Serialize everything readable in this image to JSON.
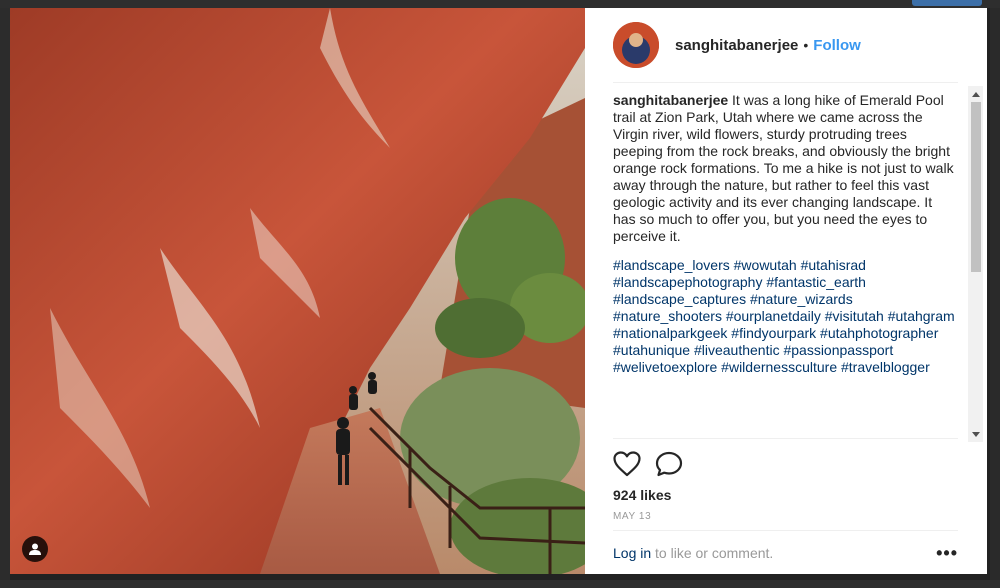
{
  "post": {
    "username": "sanghitabanerjee",
    "separator": "•",
    "follow_label": "Follow",
    "caption": "It was a long hike of Emerald Pool trail at Zion Park, Utah where we came across the Virgin river, wild flowers, sturdy protruding trees peeping from the rock breaks, and obviously the bright orange rock formations. To me a hike is not just to walk away through the nature, but rather to feel this vast geologic activity and its ever changing landscape. It has so much to offer you, but you need the eyes to perceive it.",
    "hashtags": "#landscape_lovers #wowutah #utahisrad #landscapephotography #fantastic_earth #landscape_captures #nature_wizards #nature_shooters #ourplanetdaily #visitutah #utahgram #nationalparkgeek #findyourpark #utahphotographer #utahunique #liveauthentic #passionpassport #welivetoexplore #wildernessculture #travelblogger",
    "likes": "924 likes",
    "date": "MAY 13"
  },
  "footer": {
    "login_link": "Log in",
    "login_suffix": " to like or comment.",
    "more_label": "•••"
  },
  "icons": {
    "like": "heart-icon",
    "comment": "comment-icon",
    "user_tag": "user-icon"
  },
  "colors": {
    "link_blue": "#3897f0",
    "hashtag_blue": "#003569",
    "text": "#262626",
    "muted": "#999999"
  }
}
